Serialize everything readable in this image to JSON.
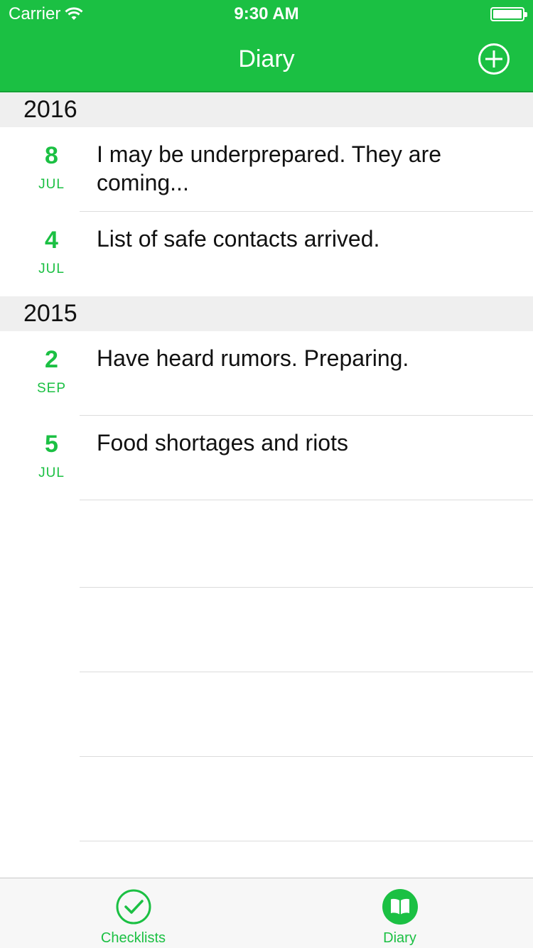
{
  "status_bar": {
    "carrier": "Carrier",
    "time": "9:30 AM"
  },
  "nav": {
    "title": "Diary",
    "add_icon": "plus-circle-icon"
  },
  "colors": {
    "accent": "#1bc043",
    "section_bg": "#efefef",
    "separator": "#dcdcdc"
  },
  "sections": [
    {
      "year": "2016",
      "entries": [
        {
          "day": "8",
          "month": "JUL",
          "text": "I may be underprepared. They are coming..."
        },
        {
          "day": "4",
          "month": "JUL",
          "text": "List of safe contacts arrived."
        }
      ]
    },
    {
      "year": "2015",
      "entries": [
        {
          "day": "2",
          "month": "SEP",
          "text": "Have heard rumors. Preparing."
        },
        {
          "day": "5",
          "month": "JUL",
          "text": "Food shortages and riots"
        }
      ]
    }
  ],
  "tabs": [
    {
      "label": "Checklists",
      "icon": "check-circle-icon",
      "selected": false
    },
    {
      "label": "Diary",
      "icon": "book-icon",
      "selected": true
    }
  ]
}
